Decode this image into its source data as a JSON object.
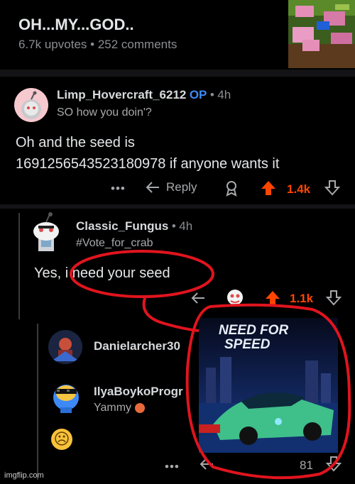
{
  "post": {
    "title": "OH...MY...GOD..",
    "upvotes": "6.7k upvotes",
    "separator": "•",
    "comments": "252 comments"
  },
  "comment1": {
    "username": "Limp_Hovercraft_6212",
    "op_badge": "OP",
    "dot": "•",
    "time": "4h",
    "flair": "SO how you doin'?",
    "body_line1": "Oh and the seed is",
    "body_line2": "1691256543523180978 if anyone wants it",
    "more": "•••",
    "reply": "Reply",
    "score": "1.4k"
  },
  "comment2": {
    "username": "Classic_Fungus",
    "dot": "•",
    "time": "4h",
    "flair": "#Vote_for_crab",
    "body": "Yes, i need your seed",
    "score": "1.1k"
  },
  "comment3": {
    "username": "Danielarcher30"
  },
  "comment4": {
    "username": "IlyaBoykoProgr",
    "flair": "Yammy",
    "emoji": "☹"
  },
  "bottom": {
    "more": "•••",
    "score": "81"
  },
  "overlay": {
    "logo_line1": "NEED FOR",
    "logo_line2": "SPEED"
  },
  "watermark": "imgflip.com",
  "colors": {
    "accent_orange": "#ff4500",
    "op_blue": "#3d8af7",
    "annotation_red": "#e0141e"
  }
}
